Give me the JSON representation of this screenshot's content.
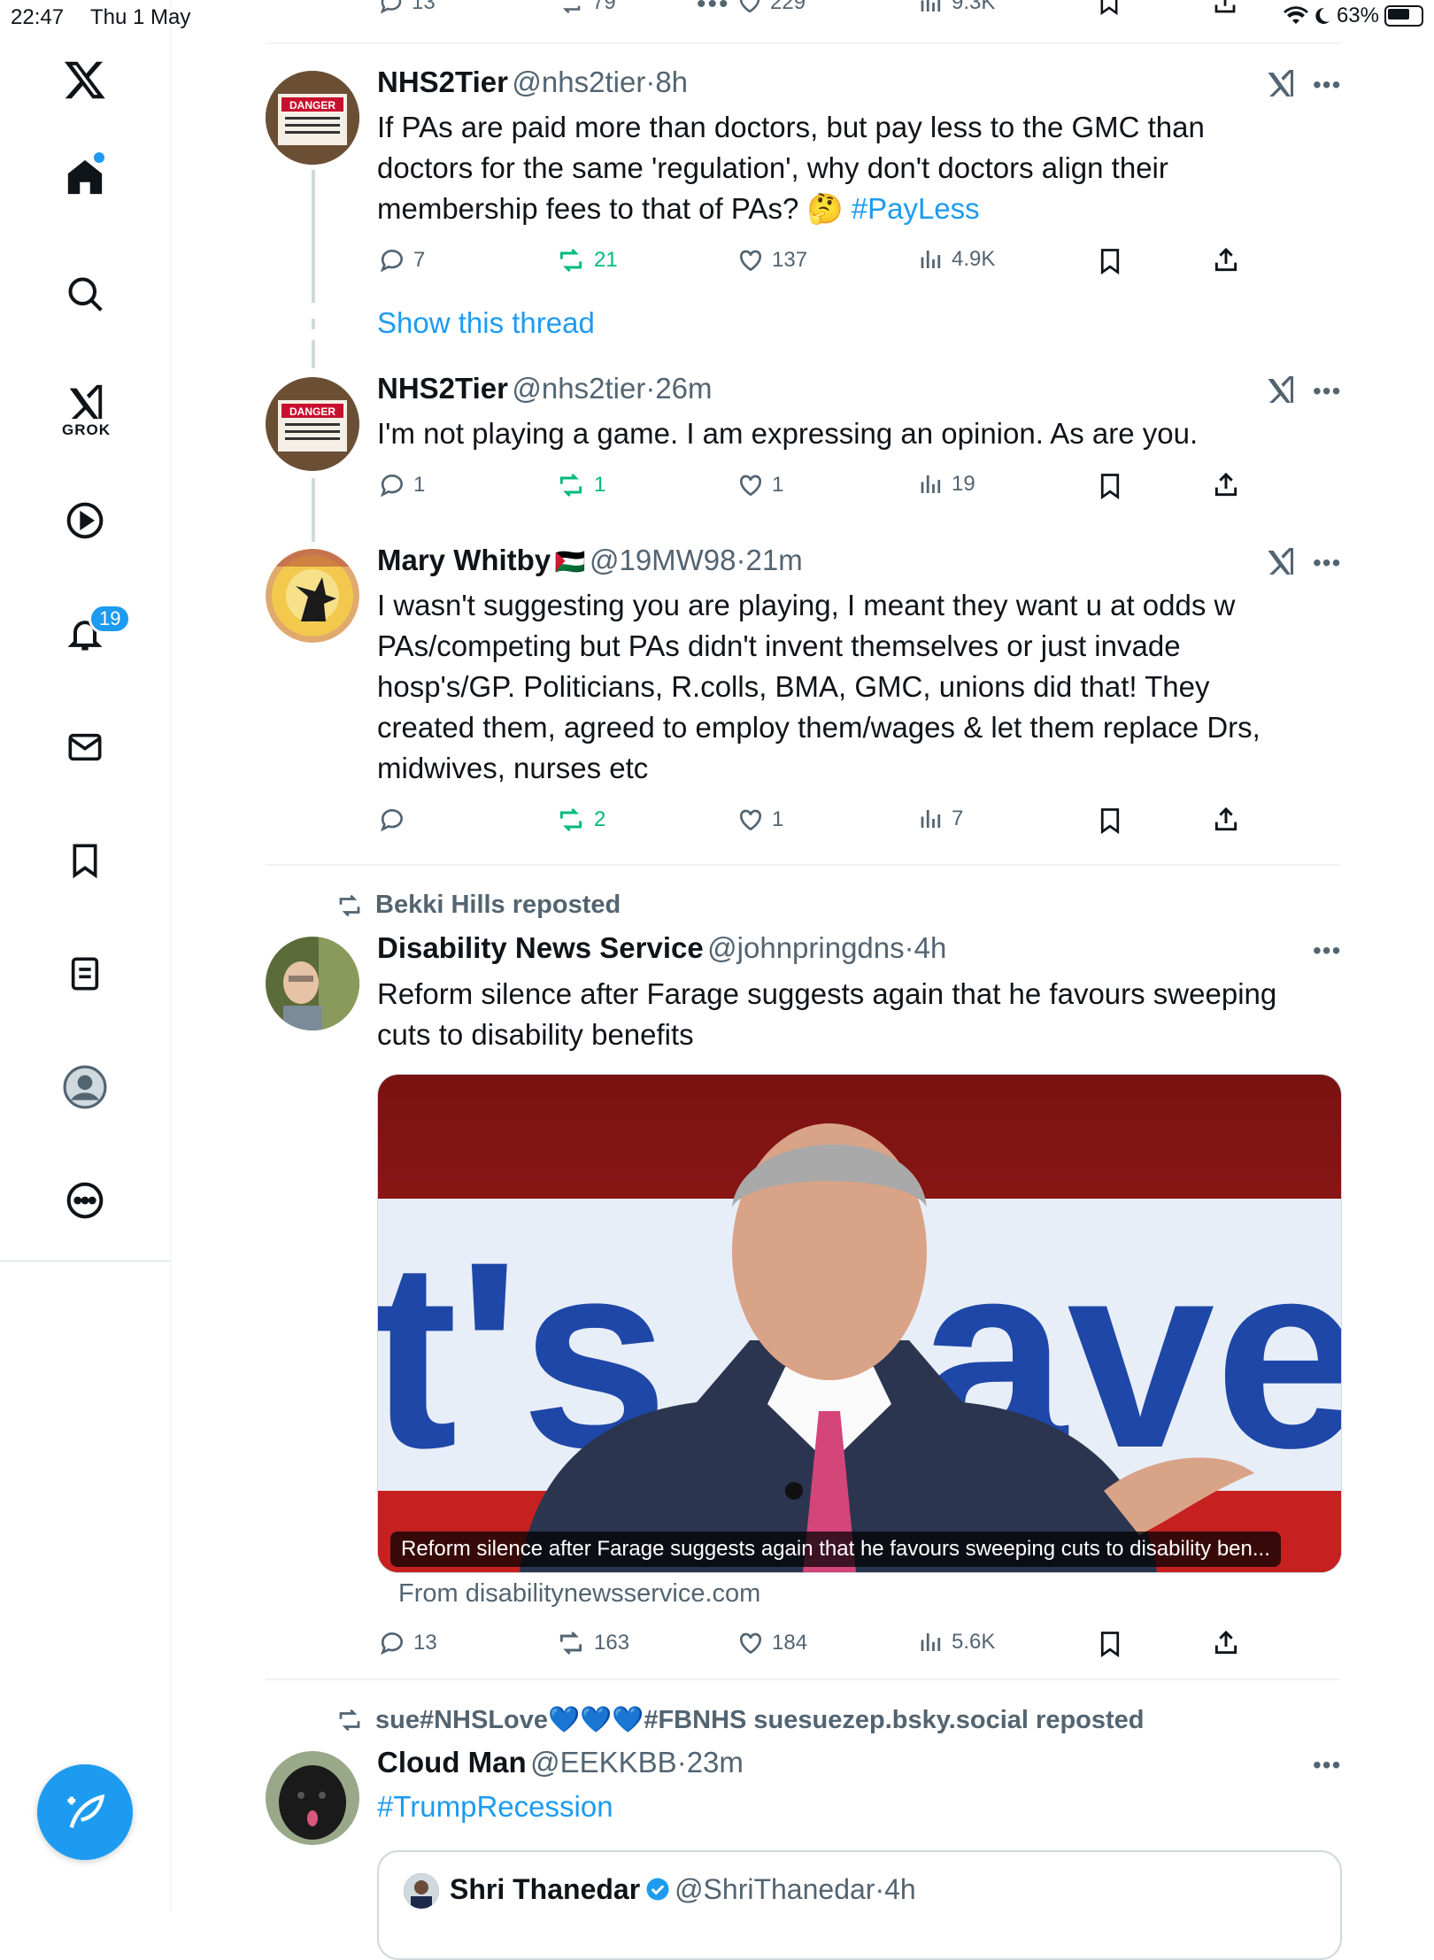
{
  "status_bar": {
    "time": "22:47",
    "date": "Thu 1 May",
    "battery": "63%"
  },
  "sidebar": {
    "logo": "x-logo",
    "items": [
      {
        "name": "home",
        "icon": "home-icon"
      },
      {
        "name": "search",
        "icon": "search-icon"
      },
      {
        "name": "grok",
        "icon": "grok-icon",
        "label": "GROK"
      },
      {
        "name": "video",
        "icon": "play-icon"
      },
      {
        "name": "notifications",
        "icon": "bell-icon",
        "badge": "19"
      },
      {
        "name": "messages",
        "icon": "mail-icon"
      },
      {
        "name": "bookmarks",
        "icon": "bookmark-icon"
      },
      {
        "name": "lists",
        "icon": "list-icon"
      },
      {
        "name": "profile",
        "icon": "profile-icon"
      },
      {
        "name": "more",
        "icon": "more-icon"
      }
    ]
  },
  "top_partial_actions": {
    "replies": "13",
    "reposts": "79",
    "likes": "229",
    "views": "9.3K"
  },
  "tweets": [
    {
      "name": "NHS2Tier",
      "handle": "@nhs2tier",
      "sep": "·",
      "time": "8h",
      "text_lines": [
        "If PAs are paid more than doctors, but pay less to the GMC than",
        "doctors for the same 'regulation', why don't doctors align their",
        "membership fees to that of PAs? 🤔"
      ],
      "hashtag": "#PayLess",
      "replies": "7",
      "reposts": "21",
      "likes": "137",
      "views": "4.9K",
      "show_thread": "Show this thread"
    },
    {
      "name": "NHS2Tier",
      "handle": "@nhs2tier",
      "sep": "·",
      "time": "26m",
      "text_lines": [
        "I'm not playing a game. I am expressing an opinion. As are you."
      ],
      "replies": "1",
      "reposts": "1",
      "likes": "1",
      "views": "19"
    },
    {
      "name": "Mary Whitby",
      "flag": "🇵🇸",
      "handle": "@19MW98",
      "sep": "·",
      "time": "21m",
      "text_lines": [
        "I wasn't suggesting you are playing, I meant they want u at odds w",
        "PAs/competing but PAs didn't invent themselves or just invade",
        "hosp's/GP. Politicians, R.colls, BMA, GMC, unions did that! They",
        "created them, agreed to employ them/wages & let them replace Drs,",
        "midwives, nurses etc"
      ],
      "replies": "",
      "reposts": "2",
      "likes": "1",
      "views": "7"
    },
    {
      "reposted_by": "Bekki Hills reposted",
      "name": "Disability News Service",
      "handle": "@johnpringdns",
      "sep": "·",
      "time": "4h",
      "text_lines": [
        "Reform silence after Farage suggests again that he favours sweeping",
        "cuts to disability benefits"
      ],
      "card_caption": "Reform silence after Farage suggests again that he favours sweeping cuts to disability ben...",
      "card_banner_text": "t's Save",
      "card_source": "From disabilitynewsservice.com",
      "replies": "13",
      "reposts": "163",
      "likes": "184",
      "views": "5.6K"
    },
    {
      "reposted_by": "sue#NHSLove💙💙💙#FBNHS suesuezep.bsky.social reposted",
      "name": "Cloud Man",
      "handle": "@EEKKBB",
      "sep": "·",
      "time": "23m",
      "hashtag": "#TrumpRecession",
      "quote": {
        "name": "Shri Thanedar",
        "handle": "@ShriThanedar",
        "sep": "·",
        "time": "4h"
      }
    }
  ]
}
